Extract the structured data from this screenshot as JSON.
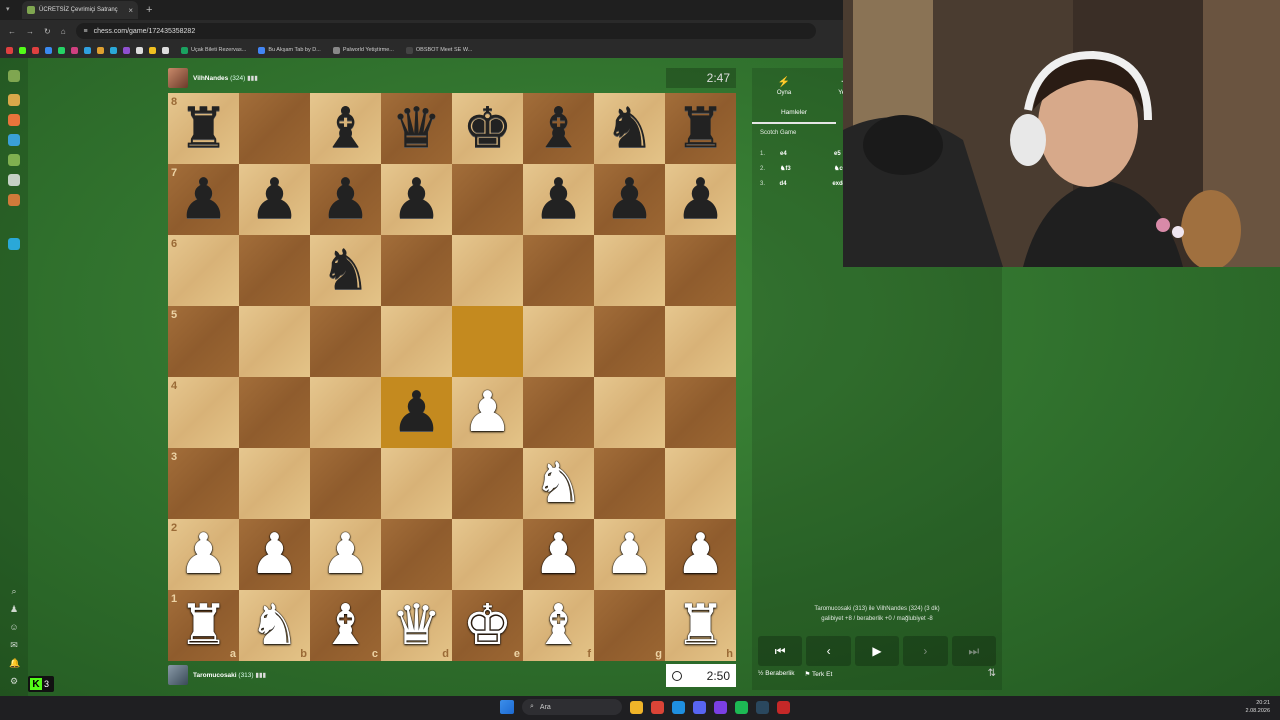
{
  "browser": {
    "tab_title": "ÜCRETSİZ Çevrimiçi Satranç",
    "new_tab": "+",
    "url": "chess.com/game/172435358282",
    "bookmarks": [
      {
        "label": "Uçak Bileti Rezervas...",
        "color": "#1aa260"
      },
      {
        "label": "Bu Akşam Tab by D...",
        "color": "#4285f4"
      },
      {
        "label": "Palworld Yetiştirme...",
        "color": "#888888"
      },
      {
        "label": "OBSBOT Meet SE W...",
        "color": "#444444"
      }
    ]
  },
  "kick_badge": {
    "letter": "K",
    "count": "3"
  },
  "opponent": {
    "name": "VilhNandes",
    "rating": "(324)",
    "clock": "2:47"
  },
  "player": {
    "name": "Taromucosaki",
    "rating": "(313)",
    "clock": "2:50"
  },
  "board": {
    "highlight_squares": [
      "d4",
      "e5"
    ],
    "ranks": [
      "8",
      "7",
      "6",
      "5",
      "4",
      "3",
      "2",
      "1"
    ],
    "files": [
      "a",
      "b",
      "c",
      "d",
      "e",
      "f",
      "g",
      "h"
    ],
    "pieces": {
      "a8": {
        "glyph": "♜",
        "color": "b",
        "name": "black-rook"
      },
      "c8": {
        "glyph": "♝",
        "color": "b",
        "name": "black-bishop"
      },
      "d8": {
        "glyph": "♛",
        "color": "b",
        "name": "black-queen"
      },
      "e8": {
        "glyph": "♚",
        "color": "b",
        "name": "black-king"
      },
      "f8": {
        "glyph": "♝",
        "color": "b",
        "name": "black-bishop"
      },
      "g8": {
        "glyph": "♞",
        "color": "b",
        "name": "black-knight"
      },
      "h8": {
        "glyph": "♜",
        "color": "b",
        "name": "black-rook"
      },
      "a7": {
        "glyph": "♟",
        "color": "b",
        "name": "black-pawn"
      },
      "b7": {
        "glyph": "♟",
        "color": "b",
        "name": "black-pawn"
      },
      "c7": {
        "glyph": "♟",
        "color": "b",
        "name": "black-pawn"
      },
      "d7": {
        "glyph": "♟",
        "color": "b",
        "name": "black-pawn"
      },
      "f7": {
        "glyph": "♟",
        "color": "b",
        "name": "black-pawn"
      },
      "g7": {
        "glyph": "♟",
        "color": "b",
        "name": "black-pawn"
      },
      "h7": {
        "glyph": "♟",
        "color": "b",
        "name": "black-pawn"
      },
      "c6": {
        "glyph": "♞",
        "color": "b",
        "name": "black-knight"
      },
      "d4": {
        "glyph": "♟",
        "color": "b",
        "name": "black-pawn"
      },
      "e4": {
        "glyph": "♟",
        "color": "w",
        "name": "white-pawn"
      },
      "f3": {
        "glyph": "♞",
        "color": "w",
        "name": "white-knight"
      },
      "a2": {
        "glyph": "♟",
        "color": "w",
        "name": "white-pawn"
      },
      "b2": {
        "glyph": "♟",
        "color": "w",
        "name": "white-pawn"
      },
      "c2": {
        "glyph": "♟",
        "color": "w",
        "name": "white-pawn"
      },
      "f2": {
        "glyph": "♟",
        "color": "w",
        "name": "white-pawn"
      },
      "g2": {
        "glyph": "♟",
        "color": "w",
        "name": "white-pawn"
      },
      "h2": {
        "glyph": "♟",
        "color": "w",
        "name": "white-pawn"
      },
      "a1": {
        "glyph": "♜",
        "color": "w",
        "name": "white-rook"
      },
      "b1": {
        "glyph": "♞",
        "color": "w",
        "name": "white-knight"
      },
      "c1": {
        "glyph": "♝",
        "color": "w",
        "name": "white-bishop"
      },
      "d1": {
        "glyph": "♛",
        "color": "w",
        "name": "white-queen"
      },
      "e1": {
        "glyph": "♚",
        "color": "w",
        "name": "white-king"
      },
      "f1": {
        "glyph": "♝",
        "color": "w",
        "name": "white-bishop"
      },
      "h1": {
        "glyph": "♜",
        "color": "w",
        "name": "white-rook"
      }
    }
  },
  "panel": {
    "tabs": [
      {
        "label": "Oyna",
        "icon": "⚡"
      },
      {
        "label": "Yeni",
        "icon": "+"
      }
    ],
    "subtab": "Hamleler",
    "opening": "Scotch Game",
    "moves": [
      {
        "no": "1.",
        "white": "e4",
        "black": "e5"
      },
      {
        "no": "2.",
        "white": "♞f3",
        "black": "♞c6"
      },
      {
        "no": "3.",
        "white": "d4",
        "black": "exd4"
      }
    ],
    "game_info_line1": "Taromucosaki (313) ile VilhNandes (324) (3 dk)",
    "game_info_line2": "galibiyet +8 / beraberlik +0 / mağlubiyet -8",
    "controls": {
      "first": "⏮",
      "prev": "‹",
      "play": "▶",
      "next": "›",
      "last": "⏭"
    },
    "draw_label": "Beraberlik",
    "draw_icon": "½",
    "resign_label": "Terk Et",
    "resign_icon": "⚑",
    "flip_icon": "⇅"
  },
  "taskbar": {
    "search": "Ara",
    "time": "20:21",
    "date": "2.08.2026"
  }
}
